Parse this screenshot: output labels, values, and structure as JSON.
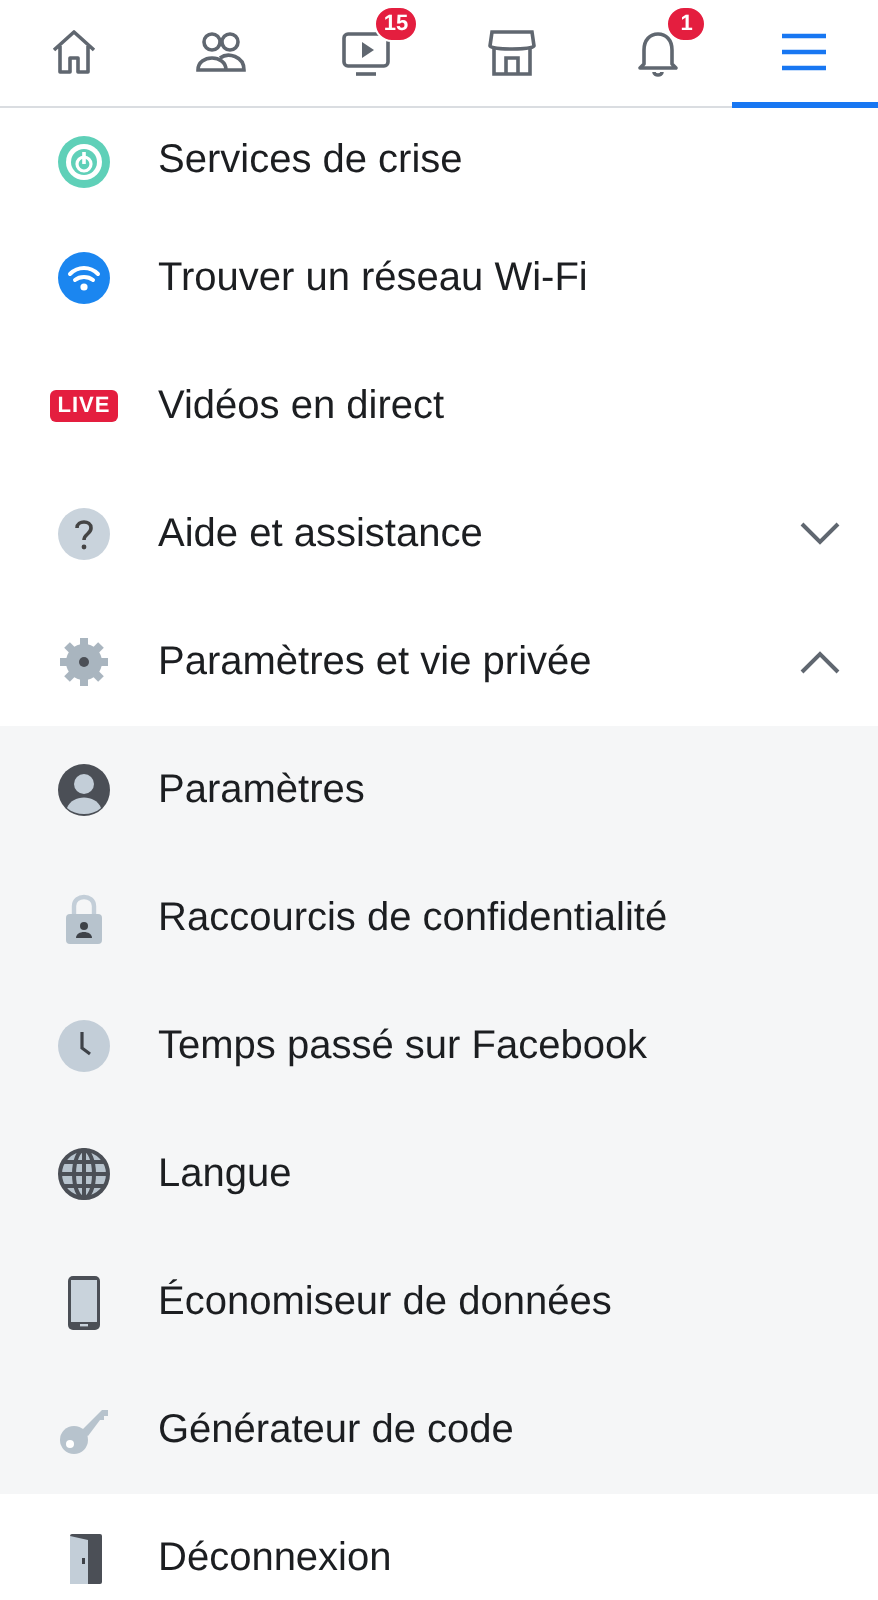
{
  "tabs": [
    {
      "selected": false
    },
    {
      "selected": false
    },
    {
      "selected": false,
      "badge": "15"
    },
    {
      "selected": false
    },
    {
      "selected": false,
      "badge": "1"
    },
    {
      "selected": true
    }
  ],
  "menu": [
    {
      "kind": "top",
      "label": "Services de crise"
    },
    {
      "kind": "top",
      "label": "Trouver un réseau Wi-Fi"
    },
    {
      "kind": "top",
      "label": "Vidéos en direct",
      "badge": "LIVE"
    },
    {
      "kind": "top",
      "label": "Aide et assistance",
      "expanded": false
    },
    {
      "kind": "top",
      "label": "Paramètres et vie privée",
      "expanded": true
    },
    {
      "kind": "sub",
      "label": "Paramètres"
    },
    {
      "kind": "sub",
      "label": "Raccourcis de confidentialité"
    },
    {
      "kind": "sub",
      "label": "Temps passé sur Facebook"
    },
    {
      "kind": "sub",
      "label": "Langue"
    },
    {
      "kind": "sub",
      "label": "Économiseur de données"
    },
    {
      "kind": "sub",
      "label": "Générateur de code"
    },
    {
      "kind": "top",
      "label": "Déconnexion"
    }
  ]
}
